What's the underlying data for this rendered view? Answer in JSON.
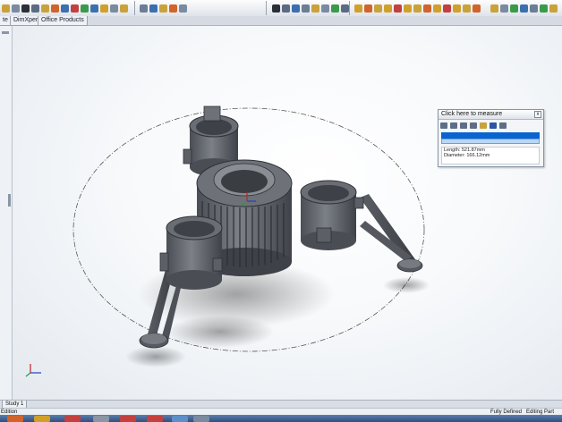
{
  "toolbar": {
    "icons": [
      "select-icon",
      "sketch-icon",
      "dimension-icon",
      "mirror-icon",
      "move-icon",
      "rotate-icon",
      "zoom-icon",
      "line-icon",
      "circle-icon",
      "arc-icon",
      "rectangle-icon",
      "trim-icon",
      "settings-icon"
    ],
    "right_icons": [
      "extrude-icon",
      "revolve-icon",
      "cut-icon",
      "fillet-icon",
      "chamfer-icon",
      "shell-icon",
      "draft-icon",
      "rib-icon",
      "pattern-icon",
      "hole-icon"
    ]
  },
  "tabs": {
    "items": [
      "te",
      "DimXpert",
      "Office Products"
    ]
  },
  "measure": {
    "title": "Click here to measure",
    "close_label": "x",
    "length": "Length: 521.87mm",
    "diameter": "Diameter: 166.12mm"
  },
  "bottom": {
    "study_tab": "Study 1"
  },
  "status": {
    "left": "Edition",
    "defined": "Fully Defined",
    "mode": "Editing Part"
  },
  "colors": {
    "part_body": "#6e7278",
    "part_dark": "#3e4147",
    "part_light": "#9ea2a8",
    "selection_blue": "#0a64d0"
  }
}
